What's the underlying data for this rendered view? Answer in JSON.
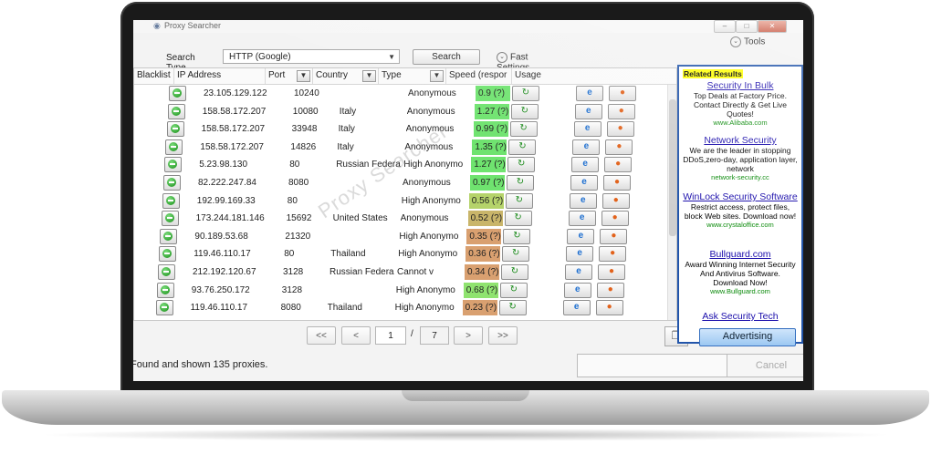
{
  "window": {
    "title": "Proxy Searcher"
  },
  "toolbar": {
    "tools_label": "Tools",
    "search_type_label": "Search Type",
    "search_type_value": "HTTP (Google)",
    "search_button": "Search",
    "fast_settings_label": "Fast Settings"
  },
  "grid": {
    "columns": [
      "Blacklist",
      "IP Address",
      "Port",
      "Country",
      "Type",
      "Speed (respor",
      "Usage"
    ],
    "watermark": "Proxy Searcher",
    "rows": [
      {
        "ip": "23.105.129.122",
        "port": "10240",
        "country": "",
        "type": "Anonymous",
        "speed": "0.9 (?)",
        "speed_color": "#6fe36f"
      },
      {
        "ip": "158.58.172.207",
        "port": "10080",
        "country": "Italy",
        "type": "Anonymous",
        "speed": "1.27 (?)",
        "speed_color": "#6fe36f"
      },
      {
        "ip": "158.58.172.207",
        "port": "33948",
        "country": "Italy",
        "type": "Anonymous",
        "speed": "0.99 (?)",
        "speed_color": "#6fe36f"
      },
      {
        "ip": "158.58.172.207",
        "port": "14826",
        "country": "Italy",
        "type": "Anonymous",
        "speed": "1.35 (?)",
        "speed_color": "#6fe36f"
      },
      {
        "ip": "5.23.98.130",
        "port": "80",
        "country": "Russian Federa",
        "type": "High Anonymo",
        "speed": "1.27 (?)",
        "speed_color": "#6fe36f"
      },
      {
        "ip": "82.222.247.84",
        "port": "8080",
        "country": "",
        "type": "Anonymous",
        "speed": "0.97 (?)",
        "speed_color": "#6fe36f"
      },
      {
        "ip": "192.99.169.33",
        "port": "80",
        "country": "",
        "type": "High Anonymo",
        "speed": "0.56 (?)",
        "speed_color": "#b5d36a"
      },
      {
        "ip": "173.244.181.146",
        "port": "15692",
        "country": "United States",
        "type": "Anonymous",
        "speed": "0.52 (?)",
        "speed_color": "#c9b56a"
      },
      {
        "ip": "90.189.53.68",
        "port": "21320",
        "country": "",
        "type": "High Anonymo",
        "speed": "0.35 (?)",
        "speed_color": "#d9a070"
      },
      {
        "ip": "119.46.110.17",
        "port": "80",
        "country": "Thailand",
        "type": "High Anonymo",
        "speed": "0.36 (?)",
        "speed_color": "#d9a070"
      },
      {
        "ip": "212.192.120.67",
        "port": "3128",
        "country": "Russian Federa",
        "type": "Cannot v",
        "speed": "0.34 (?)",
        "speed_color": "#d9a070"
      },
      {
        "ip": "93.76.250.172",
        "port": "3128",
        "country": "",
        "type": "High Anonymo",
        "speed": "0.68 (?)",
        "speed_color": "#8fe36f"
      },
      {
        "ip": "119.46.110.17",
        "port": "8080",
        "country": "Thailand",
        "type": "High Anonymo",
        "speed": "0.23 (?)",
        "speed_color": "#d9a070"
      }
    ]
  },
  "pager": {
    "first": "<<",
    "prev": "<",
    "current_page": "1",
    "separator": "/",
    "total_pages": "7",
    "next": ">",
    "last": ">>"
  },
  "status": {
    "text": "Found and shown 135 proxies.",
    "cancel_button": "Cancel"
  },
  "ads": {
    "title": "Related Results",
    "items": [
      {
        "head": "Security In Bulk",
        "body": "Top Deals at Factory Price. Contact Directly & Get Live Quotes!",
        "url": "www.Alibaba.com"
      },
      {
        "head": "Network Security",
        "body": "We are the leader in stopping DDoS,zero-day, application layer, network",
        "url": "network-security.cc"
      },
      {
        "head": "WinLock Security Software",
        "body": "Restrict access, protect files, block Web sites. Download now!",
        "url": "www.crystaloffice.com"
      },
      {
        "head": "Bullguard.com",
        "body": "Award Winning Internet Security And Antivirus Software. Download Now!",
        "url": "www.Bullguard.com"
      },
      {
        "head": "Ask Security Tech",
        "body": "",
        "url": ""
      }
    ],
    "advertising_button": "Advertising"
  }
}
